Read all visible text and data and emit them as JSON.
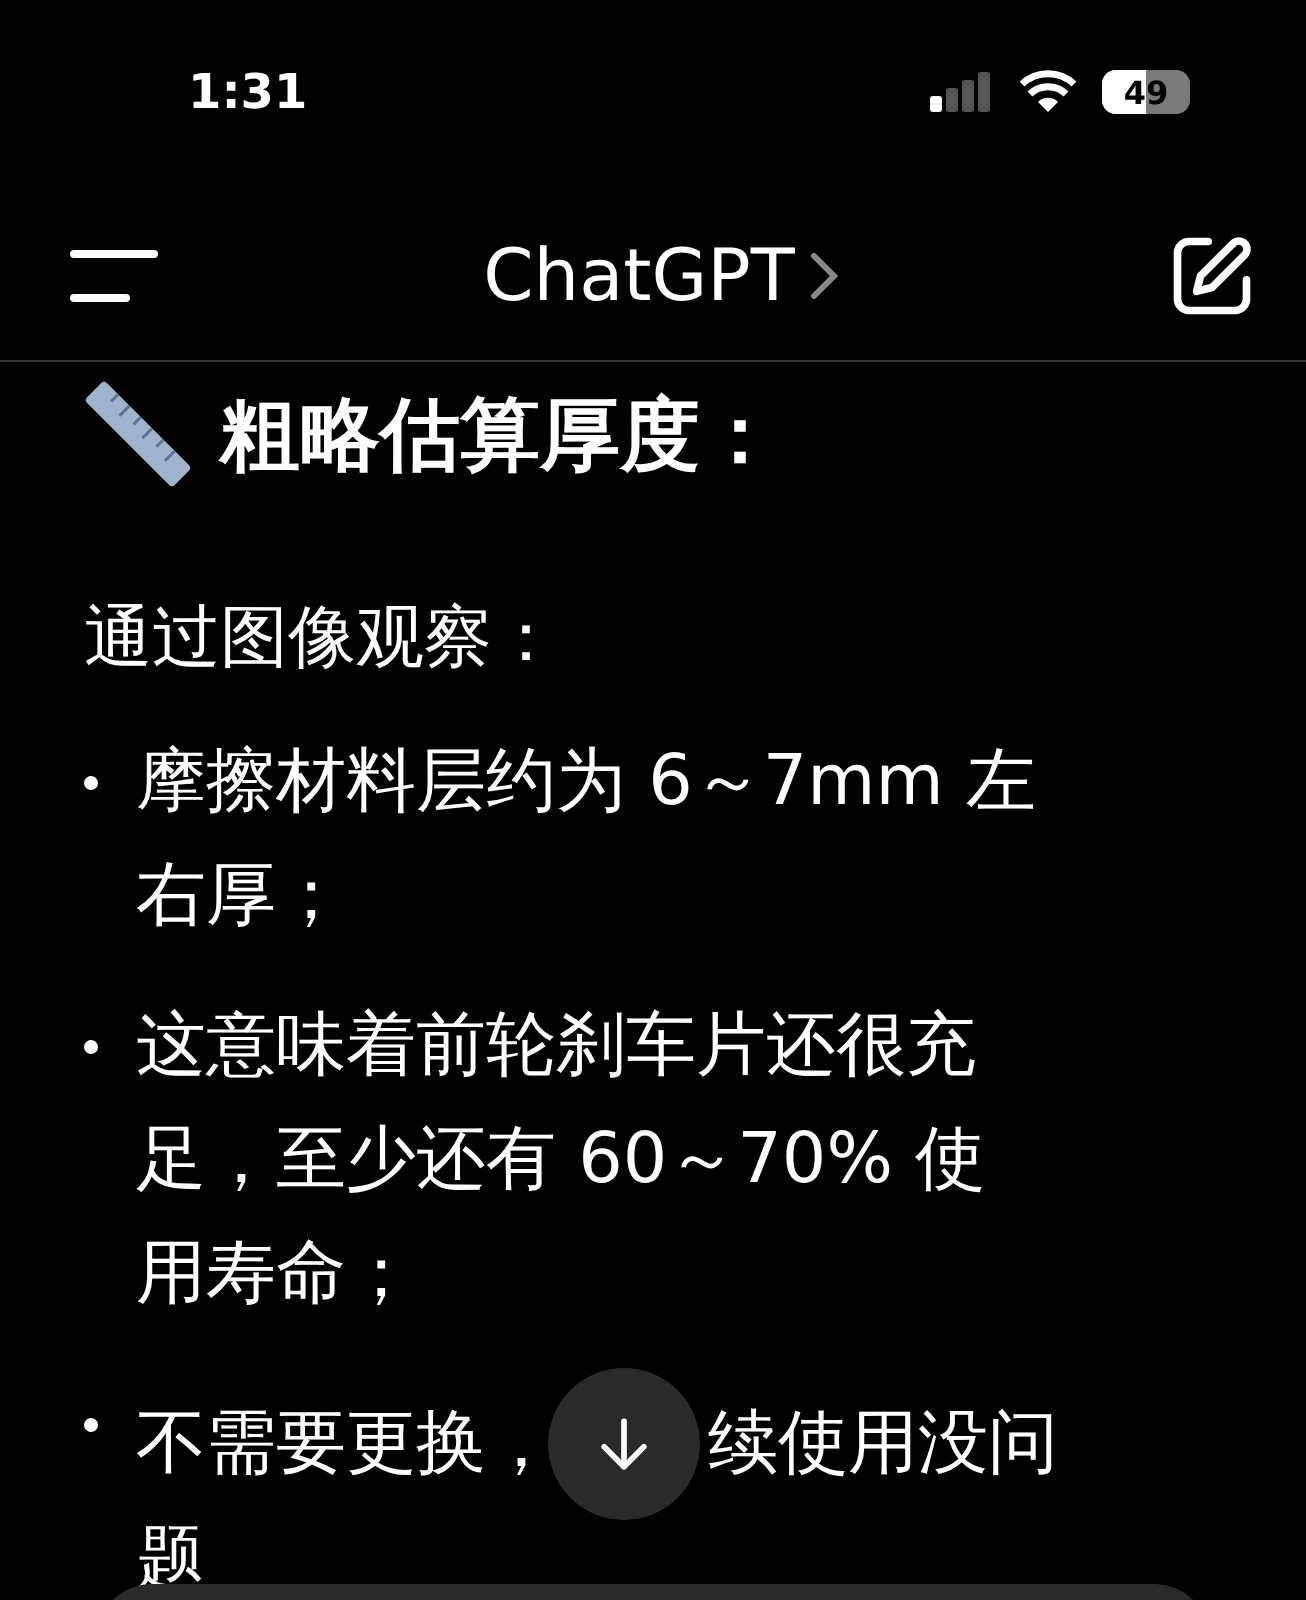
{
  "status_bar": {
    "time": "1:31",
    "battery": "49"
  },
  "header": {
    "title": "ChatGPT"
  },
  "content": {
    "heading": "粗略估算厚度：",
    "intro": "通过图像观察：",
    "bullets": [
      {
        "kind": "text",
        "text": "摩擦材料层约为 6～7mm 左右厚；"
      },
      {
        "kind": "text",
        "text": "这意味着前轮刹车片还很充足，至少还有 60～70% 使用寿命；"
      },
      {
        "kind": "covered",
        "before": "不需要更换，",
        "after": "续使用没问",
        "wrap": "题"
      }
    ]
  }
}
